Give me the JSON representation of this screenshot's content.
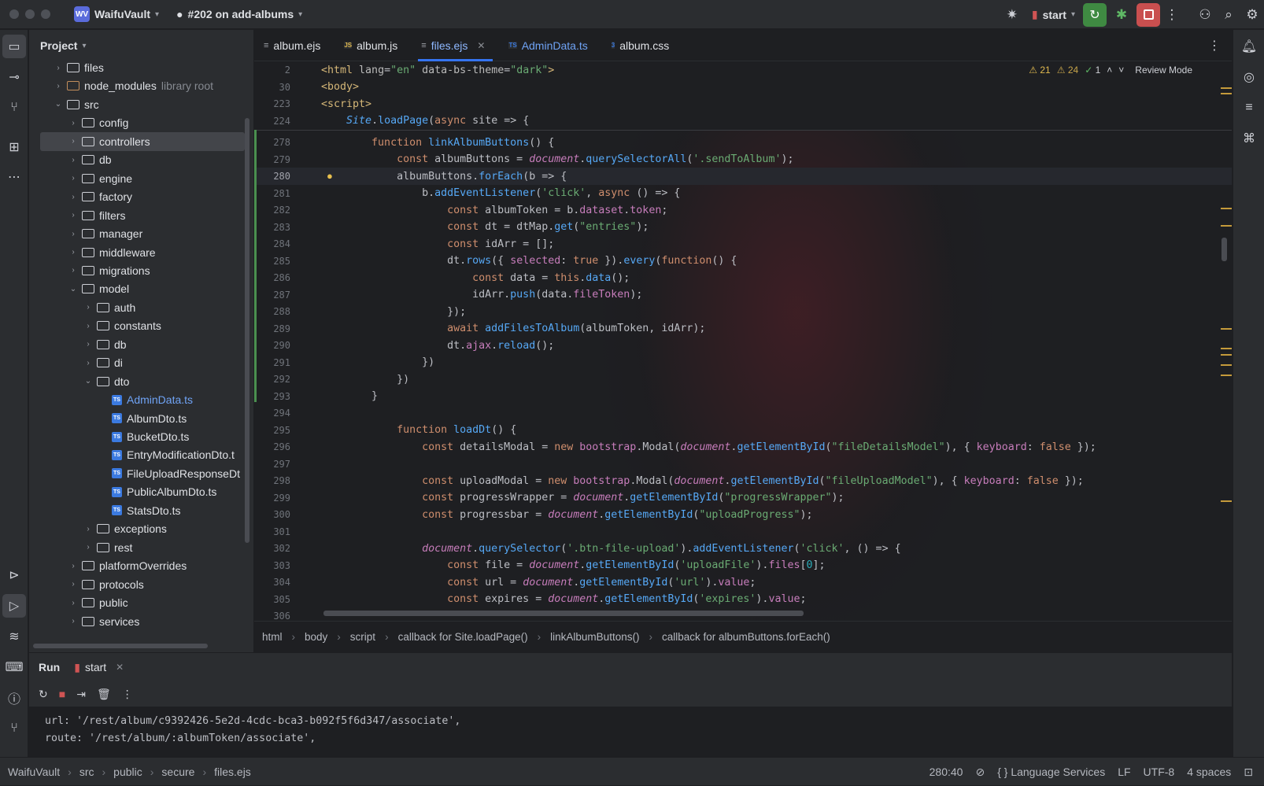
{
  "titlebar": {
    "project_badge": "WV",
    "project_name": "WaifuVault",
    "branch": "#202 on add-albums",
    "run_config": "start"
  },
  "project_panel": {
    "title": "Project",
    "tree": [
      {
        "label": "files",
        "depth": 2,
        "kind": "folder",
        "expanded": false
      },
      {
        "label": "node_modules",
        "suffix": "library root",
        "depth": 2,
        "kind": "modules",
        "expanded": false
      },
      {
        "label": "src",
        "depth": 2,
        "kind": "folder",
        "expanded": true
      },
      {
        "label": "config",
        "depth": 3,
        "kind": "folder",
        "expanded": false
      },
      {
        "label": "controllers",
        "depth": 3,
        "kind": "folder",
        "expanded": false,
        "selected": true
      },
      {
        "label": "db",
        "depth": 3,
        "kind": "folder",
        "expanded": false
      },
      {
        "label": "engine",
        "depth": 3,
        "kind": "folder",
        "expanded": false
      },
      {
        "label": "factory",
        "depth": 3,
        "kind": "folder",
        "expanded": false
      },
      {
        "label": "filters",
        "depth": 3,
        "kind": "folder",
        "expanded": false
      },
      {
        "label": "manager",
        "depth": 3,
        "kind": "folder",
        "expanded": false
      },
      {
        "label": "middleware",
        "depth": 3,
        "kind": "folder",
        "expanded": false
      },
      {
        "label": "migrations",
        "depth": 3,
        "kind": "folder",
        "expanded": false
      },
      {
        "label": "model",
        "depth": 3,
        "kind": "folder",
        "expanded": true
      },
      {
        "label": "auth",
        "depth": 4,
        "kind": "folder",
        "expanded": false
      },
      {
        "label": "constants",
        "depth": 4,
        "kind": "folder",
        "expanded": false
      },
      {
        "label": "db",
        "depth": 4,
        "kind": "folder",
        "expanded": false
      },
      {
        "label": "di",
        "depth": 4,
        "kind": "folder",
        "expanded": false
      },
      {
        "label": "dto",
        "depth": 4,
        "kind": "folder",
        "expanded": true
      },
      {
        "label": "AdminData.ts",
        "depth": 5,
        "kind": "ts",
        "highlight": true
      },
      {
        "label": "AlbumDto.ts",
        "depth": 5,
        "kind": "ts"
      },
      {
        "label": "BucketDto.ts",
        "depth": 5,
        "kind": "ts"
      },
      {
        "label": "EntryModificationDto.t",
        "depth": 5,
        "kind": "ts"
      },
      {
        "label": "FileUploadResponseDt",
        "depth": 5,
        "kind": "ts"
      },
      {
        "label": "PublicAlbumDto.ts",
        "depth": 5,
        "kind": "ts"
      },
      {
        "label": "StatsDto.ts",
        "depth": 5,
        "kind": "ts"
      },
      {
        "label": "exceptions",
        "depth": 4,
        "kind": "folder",
        "expanded": false
      },
      {
        "label": "rest",
        "depth": 4,
        "kind": "folder",
        "expanded": false
      },
      {
        "label": "platformOverrides",
        "depth": 3,
        "kind": "folder",
        "expanded": false
      },
      {
        "label": "protocols",
        "depth": 3,
        "kind": "folder",
        "expanded": false
      },
      {
        "label": "public",
        "depth": 3,
        "kind": "folder",
        "expanded": false
      },
      {
        "label": "services",
        "depth": 3,
        "kind": "folder",
        "expanded": false
      }
    ]
  },
  "editor": {
    "tabs": [
      {
        "label": "album.ejs",
        "icon": "ejs-icon",
        "active": false
      },
      {
        "label": "album.js",
        "icon": "js-icon",
        "active": false
      },
      {
        "label": "files.ejs",
        "icon": "ejs-icon",
        "active": true
      },
      {
        "label": "AdminData.ts",
        "icon": "ts-icon",
        "active": false
      },
      {
        "label": "album.css",
        "icon": "css-icon",
        "active": false
      }
    ],
    "inspections": {
      "errors": "21",
      "warnings": "24",
      "ok": "1",
      "mode": "Review Mode"
    },
    "sticky_lines": [
      {
        "ln": "2",
        "html": "<span class=\"tag\">&lt;html</span> <span class=\"attr\">lang</span>=<span class=\"str\">\"en\"</span> <span class=\"attr\">data-bs-theme</span>=<span class=\"str\">\"dark\"</span><span class=\"tag\">&gt;</span>"
      },
      {
        "ln": "30",
        "html": "<span class=\"tag\">&lt;body&gt;</span>"
      },
      {
        "ln": "223",
        "html": "<span class=\"tag\">&lt;script&gt;</span>"
      },
      {
        "ln": "224",
        "html": "    <span class=\"type\">Site</span>.<span class=\"fn\">loadPage</span>(<span class=\"kw\">async</span> site =&gt; {"
      }
    ],
    "lines": [
      {
        "ln": "278",
        "html": "        <span class=\"kw\">function</span> <span class=\"fn\">linkAlbumButtons</span>() {"
      },
      {
        "ln": "279",
        "html": "            <span class=\"kw\">const</span> albumButtons = <span class=\"glob\">document</span>.<span class=\"fn\">querySelectorAll</span>(<span class=\"str\">'.sendToAlbum'</span>);"
      },
      {
        "ln": "280",
        "html": "            albumButtons.<span class=\"fn\">forEach</span>(b =&gt; {",
        "current": true
      },
      {
        "ln": "281",
        "html": "                b.<span class=\"fn\">addEventListener</span>(<span class=\"str\">'click'</span>, <span class=\"kw\">async</span> () =&gt; {"
      },
      {
        "ln": "282",
        "html": "                    <span class=\"kw\">const</span> albumToken = b.<span class=\"prop\">dataset</span>.<span class=\"prop\">token</span>;"
      },
      {
        "ln": "283",
        "html": "                    <span class=\"kw\">const</span> dt = dtMap.<span class=\"fn\">get</span>(<span class=\"str\">\"entries\"</span>);"
      },
      {
        "ln": "284",
        "html": "                    <span class=\"kw\">const</span> idArr = [];"
      },
      {
        "ln": "285",
        "html": "                    dt.<span class=\"fn\">rows</span>({ <span class=\"prop\">selected</span>: <span class=\"kw\">true</span> }).<span class=\"fn\">every</span>(<span class=\"kw\">function</span>() {"
      },
      {
        "ln": "286",
        "html": "                        <span class=\"kw\">const</span> data = <span class=\"kw\">this</span>.<span class=\"fn\">data</span>();"
      },
      {
        "ln": "287",
        "html": "                        idArr.<span class=\"fn\">push</span>(data.<span class=\"prop\">fileToken</span>);"
      },
      {
        "ln": "288",
        "html": "                    });"
      },
      {
        "ln": "289",
        "html": "                    <span class=\"kw\">await</span> <span class=\"fn\">addFilesToAlbum</span>(albumToken, idArr);"
      },
      {
        "ln": "290",
        "html": "                    dt.<span class=\"prop\">ajax</span>.<span class=\"fn\">reload</span>();"
      },
      {
        "ln": "291",
        "html": "                })"
      },
      {
        "ln": "292",
        "html": "            })"
      },
      {
        "ln": "293",
        "html": "        }"
      },
      {
        "ln": "294",
        "html": ""
      },
      {
        "ln": "295",
        "html": "            <span class=\"kw\">function</span> <span class=\"fn\">loadDt</span>() {"
      },
      {
        "ln": "296",
        "html": "                <span class=\"kw\">const</span> detailsModal = <span class=\"kw\">new</span> <span class=\"prop\">bootstrap</span>.Modal(<span class=\"glob\">document</span>.<span class=\"fn\">getElementById</span>(<span class=\"str\">\"fileDetailsModel\"</span>), { <span class=\"prop\">keyboard</span>: <span class=\"kw\">false</span> });"
      },
      {
        "ln": "297",
        "html": ""
      },
      {
        "ln": "298",
        "html": "                <span class=\"kw\">const</span> uploadModal = <span class=\"kw\">new</span> <span class=\"prop\">bootstrap</span>.Modal(<span class=\"glob\">document</span>.<span class=\"fn\">getElementById</span>(<span class=\"str\">\"fileUploadModel\"</span>), { <span class=\"prop\">keyboard</span>: <span class=\"kw\">false</span> });"
      },
      {
        "ln": "299",
        "html": "                <span class=\"kw\">const</span> progressWrapper = <span class=\"glob\">document</span>.<span class=\"fn\">getElementById</span>(<span class=\"str\">\"progressWrapper\"</span>);"
      },
      {
        "ln": "300",
        "html": "                <span class=\"kw\">const</span> progressbar = <span class=\"glob\">document</span>.<span class=\"fn\">getElementById</span>(<span class=\"str\">\"uploadProgress\"</span>);"
      },
      {
        "ln": "301",
        "html": ""
      },
      {
        "ln": "302",
        "html": "                <span class=\"glob\">document</span>.<span class=\"fn\">querySelector</span>(<span class=\"str\">'.btn-file-upload'</span>).<span class=\"fn\">addEventListener</span>(<span class=\"str\">'click'</span>, () =&gt; {"
      },
      {
        "ln": "303",
        "html": "                    <span class=\"kw\">const</span> file = <span class=\"glob\">document</span>.<span class=\"fn\">getElementById</span>(<span class=\"str\">'uploadFile'</span>).<span class=\"prop\">files</span>[<span class=\"num\">0</span>];"
      },
      {
        "ln": "304",
        "html": "                    <span class=\"kw\">const</span> url = <span class=\"glob\">document</span>.<span class=\"fn\">getElementById</span>(<span class=\"str\">'url'</span>).<span class=\"prop\">value</span>;"
      },
      {
        "ln": "305",
        "html": "                    <span class=\"kw\">const</span> expires = <span class=\"glob\">document</span>.<span class=\"fn\">getElementById</span>(<span class=\"str\">'expires'</span>).<span class=\"prop\">value</span>;"
      },
      {
        "ln": "306",
        "html": ""
      }
    ],
    "breadcrumbs": [
      "html",
      "body",
      "script",
      "callback for Site.loadPage()",
      "linkAlbumButtons()",
      "callback for albumButtons.forEach()"
    ]
  },
  "run_panel": {
    "title": "Run",
    "tab": "start",
    "console": [
      "url: '/rest/album/c9392426-5e2d-4cdc-bca3-b092f5f6d347/associate',",
      "route: '/rest/album/:albumToken/associate',"
    ]
  },
  "statusbar": {
    "path": [
      "WaifuVault",
      "src",
      "public",
      "secure",
      "files.ejs"
    ],
    "position": "280:40",
    "language_services": "Language Services",
    "line_sep": "LF",
    "encoding": "UTF-8",
    "indent": "4 spaces"
  }
}
